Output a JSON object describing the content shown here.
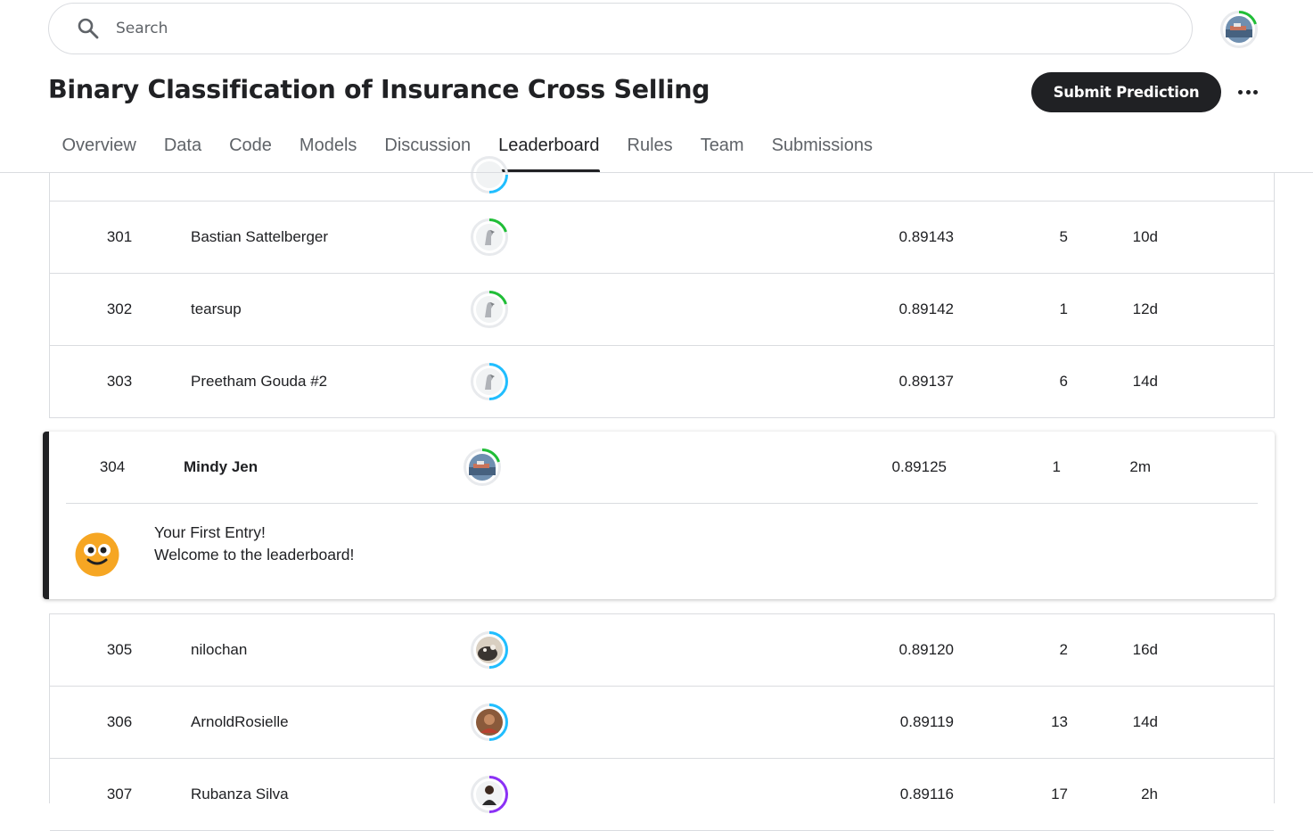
{
  "search": {
    "placeholder": "Search"
  },
  "header": {
    "title": "Binary Classification of Insurance Cross Selling",
    "submit_label": "Submit Prediction"
  },
  "tabs": [
    {
      "label": "Overview"
    },
    {
      "label": "Data"
    },
    {
      "label": "Code"
    },
    {
      "label": "Models"
    },
    {
      "label": "Discussion"
    },
    {
      "label": "Leaderboard",
      "active": true
    },
    {
      "label": "Rules"
    },
    {
      "label": "Team"
    },
    {
      "label": "Submissions"
    }
  ],
  "rows_top": [
    {
      "rank": "301",
      "name": "Bastian Sattelberger",
      "score": "0.89143",
      "entries": "5",
      "last": "10d",
      "avatar": "goose-avatar",
      "ring_color": "#20be37"
    },
    {
      "rank": "302",
      "name": "tearsup",
      "score": "0.89142",
      "entries": "1",
      "last": "12d",
      "avatar": "goose-avatar",
      "ring_color": "#20be37"
    },
    {
      "rank": "303",
      "name": "Preetham Gouda #2",
      "score": "0.89137",
      "entries": "6",
      "last": "14d",
      "avatar": "goose-avatar",
      "ring_color": "#20beff"
    }
  ],
  "highlight": {
    "rank": "304",
    "name": "Mindy Jen",
    "score": "0.89125",
    "entries": "1",
    "last": "2m",
    "avatar": "ship-avatar",
    "ring_color": "#20be37",
    "message_line1": "Your First Entry!",
    "message_line2": "Welcome to the leaderboard!"
  },
  "rows_bottom": [
    {
      "rank": "305",
      "name": "nilochan",
      "score": "0.89120",
      "entries": "2",
      "last": "16d",
      "avatar": "cat-avatar",
      "ring_color": "#20beff"
    },
    {
      "rank": "306",
      "name": "ArnoldRosielle",
      "score": "0.89119",
      "entries": "13",
      "last": "14d",
      "avatar": "person-avatar",
      "ring_color": "#20beff"
    },
    {
      "rank": "307",
      "name": "Rubanza Silva",
      "score": "0.89116",
      "entries": "17",
      "last": "2h",
      "avatar": "person-avatar",
      "ring_color": "#8b31f5"
    }
  ]
}
